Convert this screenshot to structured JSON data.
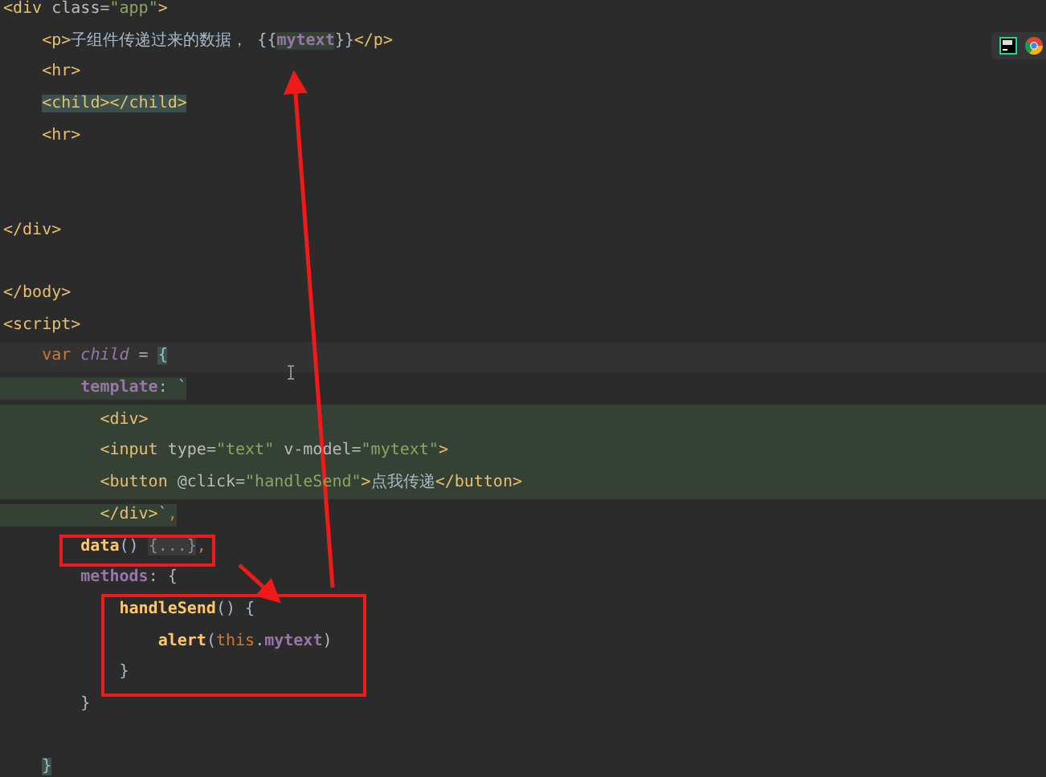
{
  "editor": {
    "lines": [
      {
        "kind": "code",
        "tokens": [
          {
            "text": "<div ",
            "kind": "tag"
          },
          {
            "text": "class=",
            "kind": "attr"
          },
          {
            "text": "\"app\"",
            "kind": "string"
          },
          {
            "text": ">",
            "kind": "tag"
          }
        ]
      },
      {
        "kind": "code",
        "tokens": [
          {
            "text": "    <p>",
            "kind": "tag"
          },
          {
            "text": "子组件传递过来的数据， {{",
            "kind": "text"
          },
          {
            "text": "mytext",
            "kind": "field",
            "highlighted": true
          },
          {
            "text": "}}",
            "kind": "text"
          },
          {
            "text": "</p>",
            "kind": "tag"
          }
        ]
      },
      {
        "kind": "code",
        "tokens": [
          {
            "text": "    <hr>",
            "kind": "tag"
          }
        ]
      },
      {
        "kind": "code",
        "tokens": [
          {
            "text": "    <child></child>",
            "kind": "tag",
            "highlighted": true
          }
        ]
      },
      {
        "kind": "code",
        "tokens": [
          {
            "text": "    <hr>",
            "kind": "tag"
          }
        ]
      },
      {
        "kind": "blank"
      },
      {
        "kind": "blank"
      },
      {
        "kind": "code",
        "tokens": [
          {
            "text": "</div>",
            "kind": "tag"
          }
        ]
      },
      {
        "kind": "blank"
      },
      {
        "kind": "code",
        "tokens": [
          {
            "text": "</body>",
            "kind": "tag"
          }
        ]
      },
      {
        "kind": "code",
        "tokens": [
          {
            "text": "<script>",
            "kind": "tag"
          }
        ]
      },
      {
        "kind": "current",
        "tokens": [
          {
            "text": "    var",
            "kind": "keyword"
          },
          {
            "text": " child",
            "kind": "local"
          },
          {
            "text": " = ",
            "kind": "text"
          },
          {
            "text": "{",
            "kind": "text",
            "highlighted": true
          }
        ]
      },
      {
        "kind": "injected-part",
        "tokens": [
          {
            "text": "        template",
            "kind": "field"
          },
          {
            "text": ": `",
            "kind": "text"
          }
        ]
      },
      {
        "kind": "injected",
        "tokens": [
          {
            "text": "          <div>",
            "kind": "tag"
          }
        ]
      },
      {
        "kind": "injected",
        "tokens": [
          {
            "text": "          <input ",
            "kind": "tag"
          },
          {
            "text": "type=",
            "kind": "attr"
          },
          {
            "text": "\"text\"",
            "kind": "string"
          },
          {
            "text": " v-model=",
            "kind": "attr"
          },
          {
            "text": "\"mytext\"",
            "kind": "string"
          },
          {
            "text": ">",
            "kind": "tag"
          }
        ]
      },
      {
        "kind": "injected",
        "tokens": [
          {
            "text": "          <button ",
            "kind": "tag"
          },
          {
            "text": "@click=",
            "kind": "attr"
          },
          {
            "text": "\"handleSend\"",
            "kind": "string"
          },
          {
            "text": ">",
            "kind": "tag"
          },
          {
            "text": "点我传递",
            "kind": "text"
          },
          {
            "text": "</button>",
            "kind": "tag"
          }
        ]
      },
      {
        "kind": "injected-part",
        "tokens": [
          {
            "text": "          </div>",
            "kind": "tag"
          },
          {
            "text": "`",
            "kind": "text"
          },
          {
            "text": ",",
            "kind": "comma"
          }
        ]
      },
      {
        "kind": "code",
        "tokens": [
          {
            "text": "        data",
            "kind": "func"
          },
          {
            "text": "() ",
            "kind": "text"
          },
          {
            "text": "{...}",
            "kind": "fold",
            "highlighted": true
          },
          {
            "text": ",",
            "kind": "comma"
          }
        ]
      },
      {
        "kind": "code",
        "tokens": [
          {
            "text": "        methods",
            "kind": "field"
          },
          {
            "text": ": {",
            "kind": "text"
          }
        ]
      },
      {
        "kind": "code",
        "tokens": [
          {
            "text": "            handleSend",
            "kind": "func"
          },
          {
            "text": "() {",
            "kind": "text"
          }
        ]
      },
      {
        "kind": "code",
        "tokens": [
          {
            "text": "                alert",
            "kind": "func"
          },
          {
            "text": "(",
            "kind": "text"
          },
          {
            "text": "this",
            "kind": "keyword"
          },
          {
            "text": ".",
            "kind": "text"
          },
          {
            "text": "mytext",
            "kind": "field"
          },
          {
            "text": ")",
            "kind": "text"
          }
        ]
      },
      {
        "kind": "code",
        "tokens": [
          {
            "text": "            }",
            "kind": "text"
          }
        ]
      },
      {
        "kind": "code",
        "tokens": [
          {
            "text": "        }",
            "kind": "text"
          }
        ]
      },
      {
        "kind": "blank"
      },
      {
        "kind": "code",
        "tokens": [
          {
            "text": "    }",
            "kind": "text",
            "highlighted": true
          }
        ]
      }
    ]
  }
}
